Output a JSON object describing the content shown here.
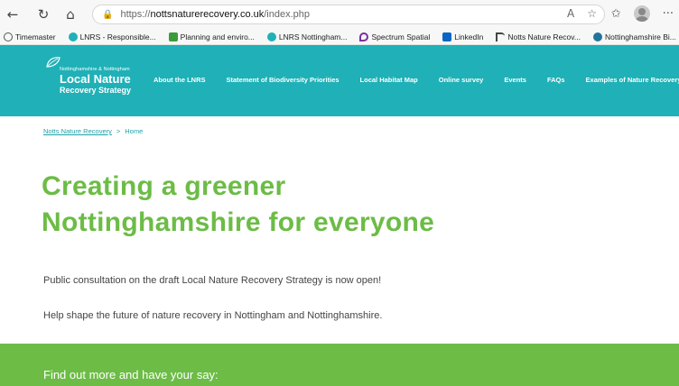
{
  "browser": {
    "url_prefix": "https://",
    "url_domain": "nottsnaturerecovery.co.uk",
    "url_path": "/index.php",
    "back_icon": "←",
    "refresh_icon": "↻",
    "home_icon": "⌂",
    "lock_icon": "🔒",
    "more_icon": "···"
  },
  "bookmarks": [
    {
      "label": "Timemaster",
      "color": "#555555"
    },
    {
      "label": "LNRS - Responsible...",
      "color": "#1fb1b7"
    },
    {
      "label": "Planning and enviro...",
      "color": "#3a9b3a"
    },
    {
      "label": "LNRS Nottingham...",
      "color": "#1fb1b7"
    },
    {
      "label": "Spectrum Spatial",
      "color": "#7b2fa0"
    },
    {
      "label": "LinkedIn",
      "color": "#0a66c2"
    },
    {
      "label": "Notts Nature Recov...",
      "color": "#444444"
    },
    {
      "label": "Nottinghamshire Bi...",
      "color": "#21759b"
    }
  ],
  "site": {
    "logo_small": "Nottinghamshire & Nottingham",
    "logo_big": "Local Nature",
    "logo_mid": "Recovery Strategy",
    "nav": [
      "About the LNRS",
      "Statement of Biodiversity Priorities",
      "Local Habitat Map",
      "Online survey",
      "Events",
      "FAQs",
      "Examples of Nature Recovery projects"
    ]
  },
  "breadcrumb": {
    "root": "Notts Nature Recovery",
    "separator": ">",
    "current": "Home"
  },
  "content": {
    "headline_line1": "Creating a greener",
    "headline_line2": "Nottinghamshire for everyone",
    "lead1": "Public consultation on the draft Local Nature Recovery Strategy is now open!",
    "lead2": "Help shape the future of nature recovery in Nottingham and Nottinghamshire.",
    "cta": "Find out more and have your say:"
  },
  "colors": {
    "teal": "#1fb1b7",
    "green": "#6cbc46"
  }
}
